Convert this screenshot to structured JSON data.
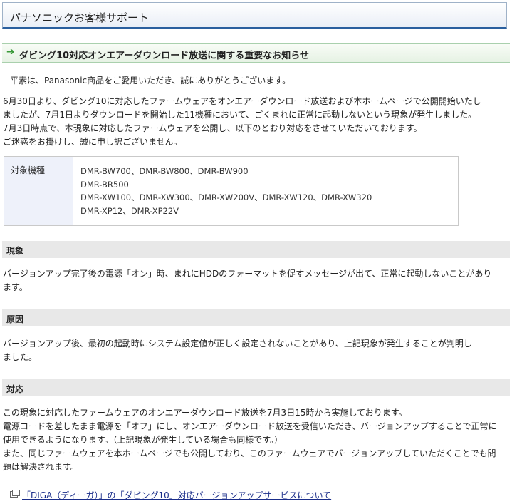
{
  "header": {
    "title": "パナソニックお客様サポート"
  },
  "notice": {
    "title": "ダビング10対応オンエアーダウンロード放送に関する重要なお知らせ"
  },
  "intro": "平素は、Panasonic商品をご愛用いただき、誠にありがとうございます。",
  "body_lines": [
    "6月30日より、ダビング10に対応したファームウェアをオンエアーダウンロード放送および本ホームページで公開開始いたし",
    "ましたが、7月1日よりダウンロードを開始した11機種において、ごくまれに正常に起動しないという現象が発生しました。",
    "7月3日時点で、本現象に対応したファームウェアを公開し、以下のとおり対応をさせていただいております。",
    "ご迷惑をお掛けし、誠に申し訳ございません。"
  ],
  "target_models": {
    "label": "対象機種",
    "lines": [
      "DMR-BW700、DMR-BW800、DMR-BW900",
      "DMR-BR500",
      "DMR-XW100、DMR-XW300、DMR-XW200V、DMR-XW120、DMR-XW320",
      "DMR-XP12、DMR-XP22V"
    ]
  },
  "sections": [
    {
      "heading": "現象",
      "lines": [
        "バージョンアップ完了後の電源「オン」時、まれにHDDのフォーマットを促すメッセージが出て、正常に起動しないことがあり",
        "ます。"
      ]
    },
    {
      "heading": "原因",
      "lines": [
        "バージョンアップ後、最初の起動時にシステム設定値が正しく設定されないことがあり、上記現象が発生することが判明し",
        "ました。"
      ]
    },
    {
      "heading": "対応",
      "lines": [
        "この現象に対応したファームウェアのオンエアーダウンロード放送を7月3日15時から実施しております。",
        "電源コードを差したまま電源を「オフ」にし、オンエアーダウンロード放送を受信いただき、バージョンアップすることで正常に",
        "使用できるようになります。（上記現象が発生している場合も同様です。）",
        "また、同じファームウェアを本ホームページでも公開しており、このファームウェアでバージョンアップしていただくことでも問",
        "題は解決されます。"
      ]
    }
  ],
  "footer_link": {
    "label": "「DIGA（ディーガ）」の「ダビング10」対応バージョンアップサービスについて",
    "icon": "new-window-icon"
  }
}
